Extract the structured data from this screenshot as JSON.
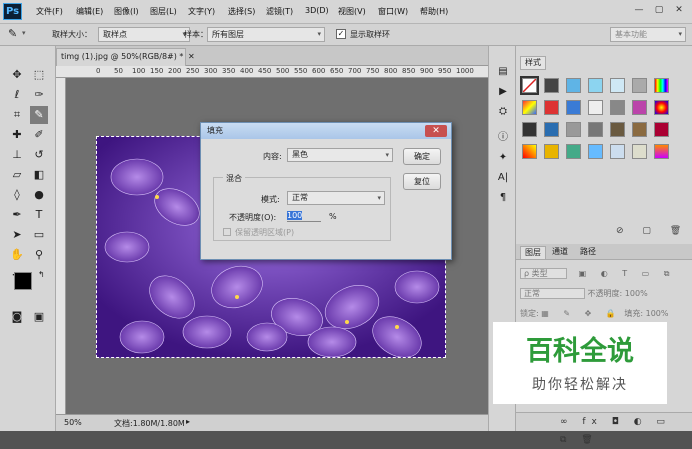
{
  "app": {
    "logo": "Ps"
  },
  "menu": [
    "文件(F)",
    "编辑(E)",
    "图像(I)",
    "图层(L)",
    "文字(Y)",
    "选择(S)",
    "滤镜(T)",
    "3D(D)",
    "视图(V)",
    "窗口(W)",
    "帮助(H)"
  ],
  "window_controls": {
    "minimize": "—",
    "restore": "▢",
    "close": "✕"
  },
  "options": {
    "sample_size_label": "取样大小：",
    "sample_size_value": "取样点",
    "sample_label": "样本：",
    "sample_value": "所有图层",
    "show_ring_label": "显示取样环",
    "show_ring_checked": true,
    "workspace": "基本功能"
  },
  "document": {
    "tab_title": "timg (1).jpg @ 50%(RGB/8#) *",
    "ruler_marks": [
      "0",
      "50",
      "100",
      "150",
      "200",
      "250",
      "300",
      "350",
      "400",
      "450",
      "500",
      "550",
      "600",
      "650",
      "700",
      "750",
      "800",
      "850",
      "900",
      "950",
      "1000"
    ],
    "zoom": "50%",
    "doc_info": "文档:1.80M/1.80M"
  },
  "fill_dialog": {
    "title": "填充",
    "content_label": "内容:",
    "content_value": "黑色",
    "ok_label": "确定",
    "reset_label": "复位",
    "blend_group": "混合",
    "mode_label": "模式:",
    "mode_value": "正常",
    "opacity_label": "不透明度(O):",
    "opacity_value": "100",
    "opacity_unit": "%",
    "preserve_transparency_label": "保留透明区域(P)"
  },
  "styles_panel": {
    "tab": "样式"
  },
  "layers_panel": {
    "tabs": [
      "图层",
      "通道",
      "路径"
    ],
    "filter_kind": "ρ 类型",
    "blend_mode": "正常",
    "opacity_label": "不透明度:",
    "opacity_value": "100%",
    "lock_label": "锁定:",
    "fill_label": "填充:",
    "fill_value": "100%",
    "footer_icons": "∞ fx ◘ ◐ ▭ ⧉ 🗑"
  },
  "watermark": {
    "main": "百科全说",
    "sub": "助你轻松解决"
  },
  "colors": {
    "accent": "#2e9b3a",
    "photo_purple": "#7b4fc9",
    "dialog_title": "#aac6e8"
  }
}
